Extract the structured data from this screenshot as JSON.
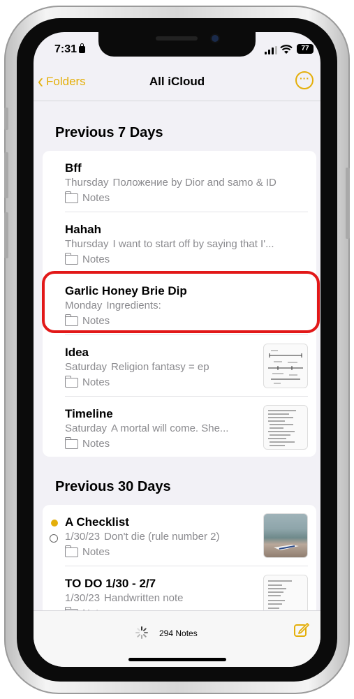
{
  "status": {
    "time": "7:31",
    "battery": "77"
  },
  "nav": {
    "back_label": "Folders",
    "title": "All iCloud"
  },
  "sections": [
    {
      "title": "Previous 7 Days",
      "notes": [
        {
          "title": "Bff",
          "date": "Thursday",
          "preview": "Положение by Dior and samo & ID",
          "folder": "Notes"
        },
        {
          "title": "Hahah",
          "date": "Thursday",
          "preview": "I want to start off by saying that I'...",
          "folder": "Notes"
        },
        {
          "title": "Garlic Honey Brie Dip",
          "date": "Monday",
          "preview": "Ingredients:",
          "folder": "Notes"
        },
        {
          "title": "Idea",
          "date": "Saturday",
          "preview": "Religion fantasy = ep",
          "folder": "Notes"
        },
        {
          "title": "Timeline",
          "date": "Saturday",
          "preview": "A mortal will come. She...",
          "folder": "Notes"
        }
      ]
    },
    {
      "title": "Previous 30 Days",
      "notes": [
        {
          "title": "A Checklist",
          "date": "1/30/23",
          "preview": "Don't die (rule number 2)",
          "folder": "Notes"
        },
        {
          "title": "TO DO 1/30 - 2/7",
          "date": "1/30/23",
          "preview": "Handwritten note",
          "folder": "Notes"
        }
      ]
    }
  ],
  "toolbar": {
    "count": "294 Notes"
  },
  "colors": {
    "accent": "#e4af0a",
    "highlight": "#e21818",
    "background": "#f2f1f6"
  }
}
